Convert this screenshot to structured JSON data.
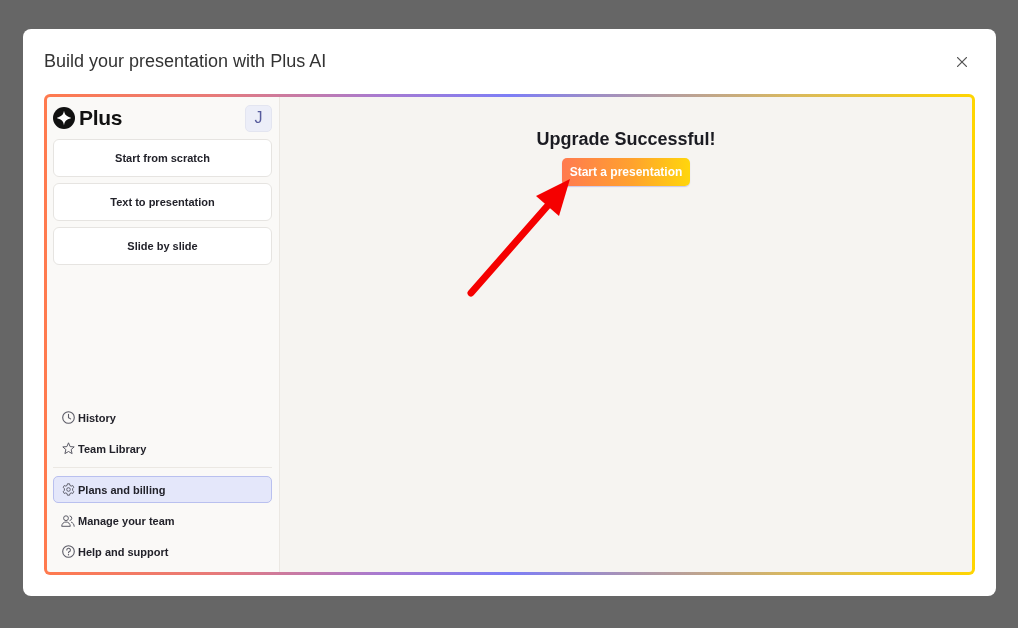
{
  "dialog": {
    "title": "Build your presentation with Plus AI"
  },
  "sidebar": {
    "logo": "Plus",
    "avatar": "J",
    "actions": [
      "Start from scratch",
      "Text to presentation",
      "Slide by slide"
    ],
    "nav_sections": [
      {
        "items": [
          {
            "kind": "history",
            "label": "History",
            "selected": false
          },
          {
            "kind": "library",
            "label": "Team Library",
            "selected": false
          }
        ]
      },
      {
        "items": [
          {
            "kind": "billing",
            "label": "Plans and billing",
            "selected": true
          },
          {
            "kind": "team",
            "label": "Manage your team",
            "selected": false
          },
          {
            "kind": "help",
            "label": "Help and support",
            "selected": false
          }
        ]
      }
    ]
  },
  "main": {
    "heading": "Upgrade Successful!",
    "button": "Start a presentation"
  }
}
